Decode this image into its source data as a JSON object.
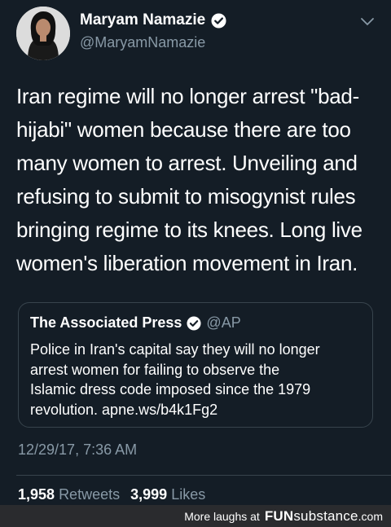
{
  "tweet": {
    "author_name": "Maryam Namazie",
    "author_handle": "@MaryamNamazie",
    "text": "Iran regime will no longer arrest \"bad-\nhijabi\" women because there are too\nmany women to arrest. Unveiling and\nrefusing to submit to misogynist rules\nbringing regime to its knees. Long live\nwomen's liberation movement in Iran.",
    "timestamp": "12/29/17, 7:36 AM",
    "retweets_count": "1,958",
    "retweets_label": "Retweets",
    "likes_count": "3,999",
    "likes_label": "Likes"
  },
  "quoted_tweet": {
    "author_name": "The Associated Press",
    "author_handle": "@AP",
    "text": "Police in Iran's capital say they will no longer\narrest women for failing to observe the\nIslamic dress code imposed since the 1979\nrevolution. apne.ws/b4k1Fg2"
  },
  "footer": {
    "caption": "More laughs at",
    "brand_bold": "FUN",
    "brand_light": "substance",
    "brand_domain": ".com"
  },
  "colors": {
    "background": "#141d26",
    "secondary_text": "#8899a6",
    "verified_blue": "#1da1f2",
    "border": "#38444d"
  }
}
